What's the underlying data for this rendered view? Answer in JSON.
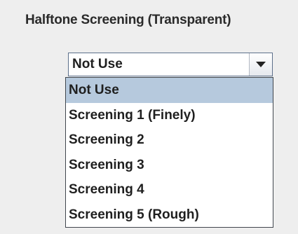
{
  "section": {
    "title": "Halftone Screening (Transparent)"
  },
  "combo": {
    "selected_value": "Not Use",
    "arrow_icon": "chevron-down-icon"
  },
  "dropdown": {
    "highlighted_index": 0,
    "options": [
      {
        "label": "Not Use"
      },
      {
        "label": "Screening 1 (Finely)"
      },
      {
        "label": "Screening 2"
      },
      {
        "label": "Screening 3"
      },
      {
        "label": "Screening 4"
      },
      {
        "label": "Screening 5 (Rough)"
      }
    ]
  },
  "colors": {
    "selection_highlight": "#b6c9dd",
    "panel_background": "#eeeeee"
  }
}
